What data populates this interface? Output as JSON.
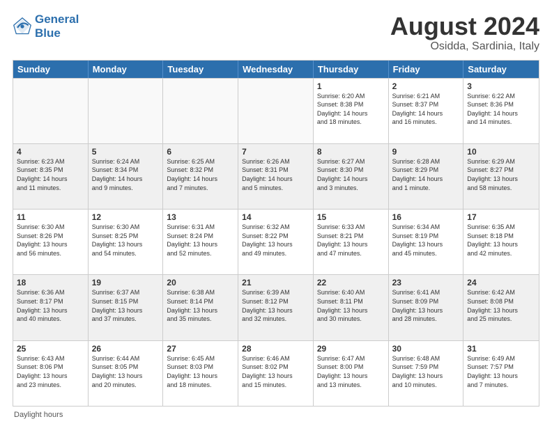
{
  "logo": {
    "line1": "General",
    "line2": "Blue"
  },
  "title": {
    "month_year": "August 2024",
    "location": "Osidda, Sardinia, Italy"
  },
  "header_days": [
    "Sunday",
    "Monday",
    "Tuesday",
    "Wednesday",
    "Thursday",
    "Friday",
    "Saturday"
  ],
  "weeks": [
    [
      {
        "day": "",
        "info": ""
      },
      {
        "day": "",
        "info": ""
      },
      {
        "day": "",
        "info": ""
      },
      {
        "day": "",
        "info": ""
      },
      {
        "day": "1",
        "info": "Sunrise: 6:20 AM\nSunset: 8:38 PM\nDaylight: 14 hours\nand 18 minutes."
      },
      {
        "day": "2",
        "info": "Sunrise: 6:21 AM\nSunset: 8:37 PM\nDaylight: 14 hours\nand 16 minutes."
      },
      {
        "day": "3",
        "info": "Sunrise: 6:22 AM\nSunset: 8:36 PM\nDaylight: 14 hours\nand 14 minutes."
      }
    ],
    [
      {
        "day": "4",
        "info": "Sunrise: 6:23 AM\nSunset: 8:35 PM\nDaylight: 14 hours\nand 11 minutes."
      },
      {
        "day": "5",
        "info": "Sunrise: 6:24 AM\nSunset: 8:34 PM\nDaylight: 14 hours\nand 9 minutes."
      },
      {
        "day": "6",
        "info": "Sunrise: 6:25 AM\nSunset: 8:32 PM\nDaylight: 14 hours\nand 7 minutes."
      },
      {
        "day": "7",
        "info": "Sunrise: 6:26 AM\nSunset: 8:31 PM\nDaylight: 14 hours\nand 5 minutes."
      },
      {
        "day": "8",
        "info": "Sunrise: 6:27 AM\nSunset: 8:30 PM\nDaylight: 14 hours\nand 3 minutes."
      },
      {
        "day": "9",
        "info": "Sunrise: 6:28 AM\nSunset: 8:29 PM\nDaylight: 14 hours\nand 1 minute."
      },
      {
        "day": "10",
        "info": "Sunrise: 6:29 AM\nSunset: 8:27 PM\nDaylight: 13 hours\nand 58 minutes."
      }
    ],
    [
      {
        "day": "11",
        "info": "Sunrise: 6:30 AM\nSunset: 8:26 PM\nDaylight: 13 hours\nand 56 minutes."
      },
      {
        "day": "12",
        "info": "Sunrise: 6:30 AM\nSunset: 8:25 PM\nDaylight: 13 hours\nand 54 minutes."
      },
      {
        "day": "13",
        "info": "Sunrise: 6:31 AM\nSunset: 8:24 PM\nDaylight: 13 hours\nand 52 minutes."
      },
      {
        "day": "14",
        "info": "Sunrise: 6:32 AM\nSunset: 8:22 PM\nDaylight: 13 hours\nand 49 minutes."
      },
      {
        "day": "15",
        "info": "Sunrise: 6:33 AM\nSunset: 8:21 PM\nDaylight: 13 hours\nand 47 minutes."
      },
      {
        "day": "16",
        "info": "Sunrise: 6:34 AM\nSunset: 8:19 PM\nDaylight: 13 hours\nand 45 minutes."
      },
      {
        "day": "17",
        "info": "Sunrise: 6:35 AM\nSunset: 8:18 PM\nDaylight: 13 hours\nand 42 minutes."
      }
    ],
    [
      {
        "day": "18",
        "info": "Sunrise: 6:36 AM\nSunset: 8:17 PM\nDaylight: 13 hours\nand 40 minutes."
      },
      {
        "day": "19",
        "info": "Sunrise: 6:37 AM\nSunset: 8:15 PM\nDaylight: 13 hours\nand 37 minutes."
      },
      {
        "day": "20",
        "info": "Sunrise: 6:38 AM\nSunset: 8:14 PM\nDaylight: 13 hours\nand 35 minutes."
      },
      {
        "day": "21",
        "info": "Sunrise: 6:39 AM\nSunset: 8:12 PM\nDaylight: 13 hours\nand 32 minutes."
      },
      {
        "day": "22",
        "info": "Sunrise: 6:40 AM\nSunset: 8:11 PM\nDaylight: 13 hours\nand 30 minutes."
      },
      {
        "day": "23",
        "info": "Sunrise: 6:41 AM\nSunset: 8:09 PM\nDaylight: 13 hours\nand 28 minutes."
      },
      {
        "day": "24",
        "info": "Sunrise: 6:42 AM\nSunset: 8:08 PM\nDaylight: 13 hours\nand 25 minutes."
      }
    ],
    [
      {
        "day": "25",
        "info": "Sunrise: 6:43 AM\nSunset: 8:06 PM\nDaylight: 13 hours\nand 23 minutes."
      },
      {
        "day": "26",
        "info": "Sunrise: 6:44 AM\nSunset: 8:05 PM\nDaylight: 13 hours\nand 20 minutes."
      },
      {
        "day": "27",
        "info": "Sunrise: 6:45 AM\nSunset: 8:03 PM\nDaylight: 13 hours\nand 18 minutes."
      },
      {
        "day": "28",
        "info": "Sunrise: 6:46 AM\nSunset: 8:02 PM\nDaylight: 13 hours\nand 15 minutes."
      },
      {
        "day": "29",
        "info": "Sunrise: 6:47 AM\nSunset: 8:00 PM\nDaylight: 13 hours\nand 13 minutes."
      },
      {
        "day": "30",
        "info": "Sunrise: 6:48 AM\nSunset: 7:59 PM\nDaylight: 13 hours\nand 10 minutes."
      },
      {
        "day": "31",
        "info": "Sunrise: 6:49 AM\nSunset: 7:57 PM\nDaylight: 13 hours\nand 7 minutes."
      }
    ]
  ],
  "footer": {
    "daylight_label": "Daylight hours"
  }
}
